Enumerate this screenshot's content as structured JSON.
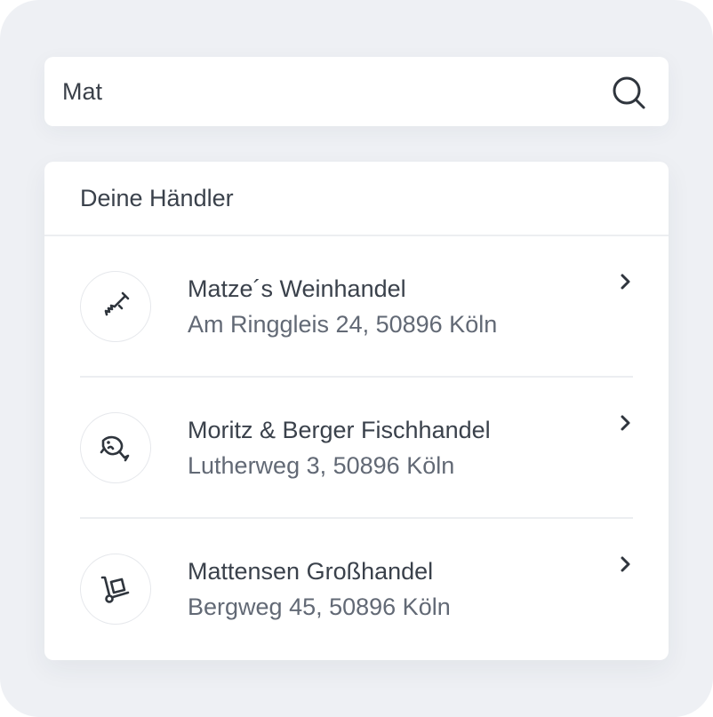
{
  "search": {
    "value": "Mat",
    "icon": "search-icon"
  },
  "merchants": {
    "title": "Deine Händler",
    "items": [
      {
        "name": "Matze´s Weinhandel",
        "address": "Am Ringgleis 24, 50896 Köln",
        "icon": "corkscrew-icon"
      },
      {
        "name": "Moritz & Berger Fischhandel",
        "address": "Lutherweg 3, 50896 Köln",
        "icon": "fish-icon"
      },
      {
        "name": "Mattensen Großhandel",
        "address": "Bergweg 45, 50896 Köln",
        "icon": "hand-truck-icon"
      }
    ]
  },
  "colors": {
    "background": "#eef0f4",
    "card": "#ffffff",
    "text_primary": "#3a414b",
    "text_secondary": "#626975"
  }
}
